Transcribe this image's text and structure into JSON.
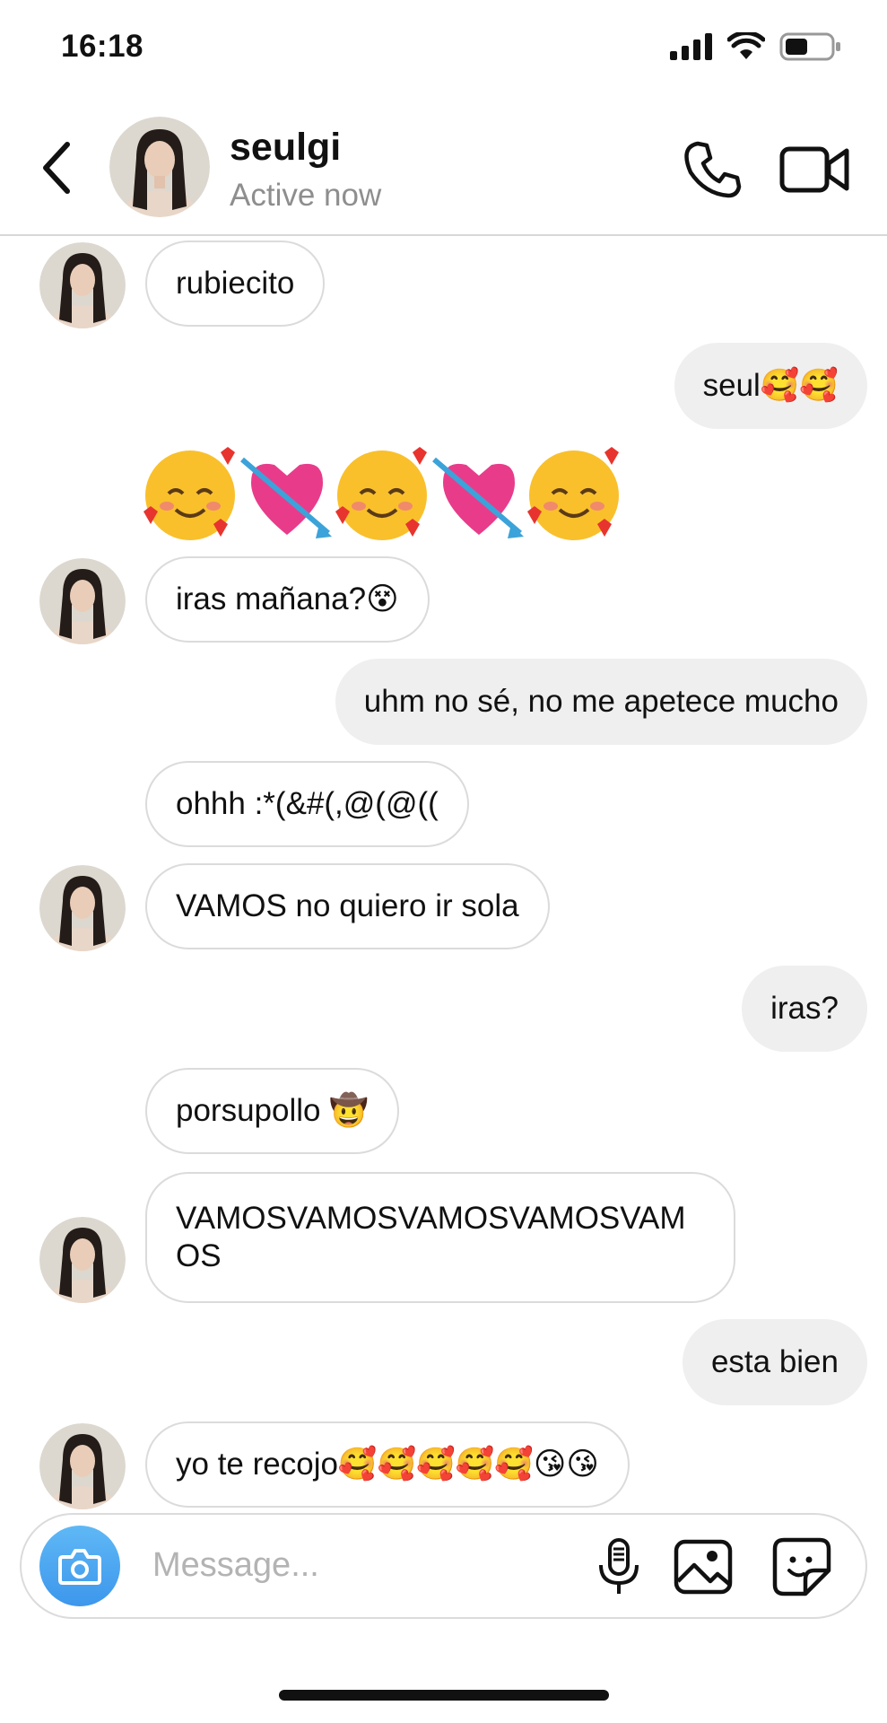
{
  "status_bar": {
    "time": "16:18"
  },
  "header": {
    "contact_name": "seulgi",
    "activity_status": "Active now"
  },
  "messages": [
    {
      "direction": "in",
      "text": "rubiecito"
    },
    {
      "direction": "out",
      "text": "seul🥰🥰"
    },
    {
      "direction": "in",
      "text": "🥰💘🥰💘🥰"
    },
    {
      "direction": "in",
      "text": "iras mañana?😵"
    },
    {
      "direction": "out",
      "text": "uhm no sé, no me apetece mucho"
    },
    {
      "direction": "in",
      "text": "ohhh :*(&#(,@(@(("
    },
    {
      "direction": "in",
      "text": "VAMOS no quiero ir sola"
    },
    {
      "direction": "out",
      "text": "iras?"
    },
    {
      "direction": "in",
      "text": "porsupollo 🤠"
    },
    {
      "direction": "in",
      "text": "VAMOSVAMOSVAMOSVAMOSVAMOS"
    },
    {
      "direction": "out",
      "text": "esta bien"
    },
    {
      "direction": "in",
      "text": "yo te recojo🥰🥰🥰🥰🥰😘😘"
    }
  ],
  "composer": {
    "placeholder": "Message..."
  },
  "icons": {
    "back": "chevron-left-icon",
    "call": "phone-icon",
    "video": "video-camera-icon",
    "camera": "camera-icon",
    "mic": "microphone-icon",
    "gallery": "image-icon",
    "sticker": "sticker-icon"
  },
  "colors": {
    "camera_button": "#3d97ec",
    "incoming_border": "#dbdbdb",
    "outgoing_fill": "#efefef",
    "secondary_text": "#8e8e8e"
  }
}
